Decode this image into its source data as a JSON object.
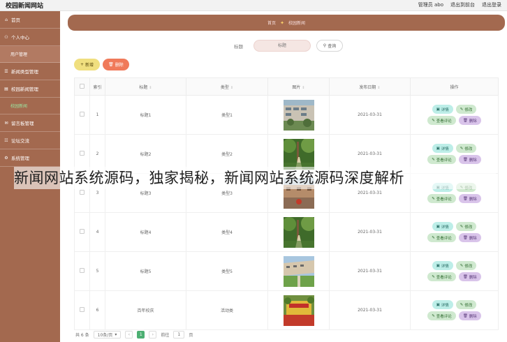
{
  "topbar": {
    "brand": "校园新闻网站",
    "user_label": "管理员 abo",
    "front_link": "退出到前台",
    "logout_link": "退出登录"
  },
  "sidebar": {
    "items": [
      {
        "label": "首页",
        "icon": "home-icon"
      },
      {
        "label": "个人中心",
        "icon": "user-icon"
      },
      {
        "label": "用户管理",
        "sub": true
      },
      {
        "label": "新闻类型管理",
        "icon": "list-icon"
      },
      {
        "label": "校园新闻管理",
        "icon": "news-icon"
      },
      {
        "label": "校园新闻",
        "sub": true,
        "active": true
      },
      {
        "label": "留言板管理",
        "icon": "message-icon"
      },
      {
        "label": "论坛交流",
        "icon": "forum-icon"
      },
      {
        "label": "系统管理",
        "icon": "gear-icon"
      }
    ],
    "accent_color": "#a3694f"
  },
  "breadcrumb": {
    "home": "首页",
    "current": "校园新闻"
  },
  "search": {
    "label": "标题",
    "placeholder": "标题",
    "button": "查询"
  },
  "actions": {
    "add": "新增",
    "delete": "删除"
  },
  "table": {
    "headers": {
      "index": "索引",
      "title": "标题",
      "type": "类型",
      "image": "图片",
      "date": "发布日期",
      "ops": "操作"
    },
    "rows": [
      {
        "index": "1",
        "title": "标题1",
        "type": "类型1",
        "date": "2021-03-31",
        "image": "campus-building-photo"
      },
      {
        "index": "2",
        "title": "标题2",
        "type": "类型2",
        "date": "2021-03-31",
        "image": "garden-path-photo"
      },
      {
        "index": "3",
        "title": "标题3",
        "type": "类型3",
        "date": "2021-03-31",
        "image": "courtyard-photo"
      },
      {
        "index": "4",
        "title": "标题4",
        "type": "类型4",
        "date": "2021-03-31",
        "image": "garden-path-photo"
      },
      {
        "index": "5",
        "title": "标题5",
        "type": "类型5",
        "date": "2021-03-31",
        "image": "campus-lawn-photo"
      },
      {
        "index": "6",
        "title": "百年校庆",
        "type": "活动类",
        "date": "2021-03-31",
        "image": "anniversary-stage-photo"
      }
    ],
    "row_actions": {
      "detail": "详情",
      "edit": "修改",
      "review": "查看评论",
      "remove": "删除"
    }
  },
  "pagination": {
    "total": "共 6 条",
    "page_size": "10条/页",
    "current_page": "1",
    "goto_label": "前往",
    "goto_value": "1",
    "page_suffix": "页"
  },
  "overlay_text": "新闻网站系统源码，独家揭秘，新闻网站系统源码深度解析"
}
